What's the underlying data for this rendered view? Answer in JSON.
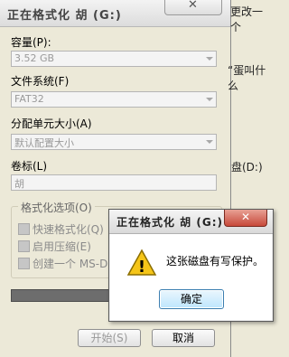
{
  "dialog": {
    "title": "正在格式化 胡 (G:)",
    "close_glyph": "✕",
    "capacity_label": "容量(P):",
    "capacity_value": "3.52 GB",
    "filesystem_label": "文件系统(F)",
    "filesystem_value": "FAT32",
    "alloc_label": "分配单元大小(A)",
    "alloc_value": "默认配置大小",
    "volume_label": "卷标(L)",
    "volume_value": "胡",
    "options_title": "格式化选项(O)",
    "options": [
      "快速格式化(Q)",
      "启用压缩(E)",
      "创建一个 MS-DOS"
    ],
    "start_button": "开始(S)",
    "cancel_button": "取消"
  },
  "background_text": {
    "line1": "更改一个",
    "line2": "“蛋叫什么",
    "line3": "盘(D:)"
  },
  "message_box": {
    "title": "正在格式化 胡 (G:)",
    "close_glyph": "✕",
    "icon_glyph": "!",
    "message": "这张磁盘有写保护。",
    "ok_button": "确定"
  },
  "colors": {
    "warning_yellow": "#f5c518",
    "close_red": "#c7493a"
  }
}
